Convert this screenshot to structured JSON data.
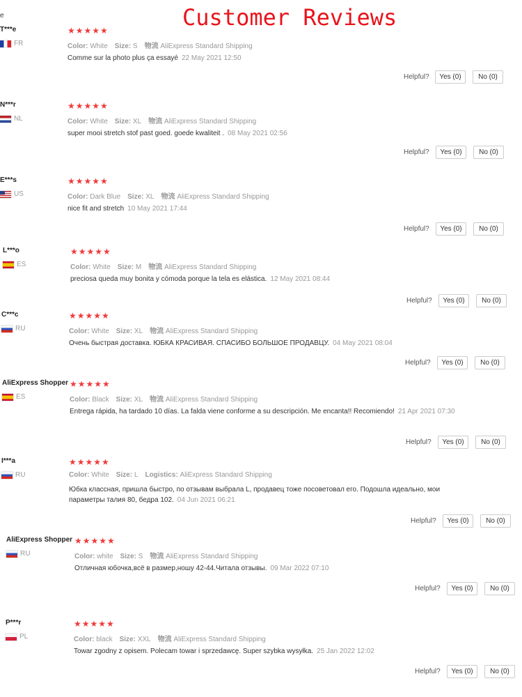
{
  "title": "Customer Reviews",
  "edge_fragment": "e",
  "labels": {
    "color": "Color:",
    "size": "Size:",
    "shipping": "物流",
    "logistics": "Logistics:",
    "helpful": "Helpful?",
    "yes": "Yes (0)",
    "no": "No (0)",
    "stars": "★★★★★"
  },
  "colors": {
    "title": "#e8141b",
    "stars": "#f03a3a"
  },
  "reviews": [
    {
      "name": "T***e",
      "country": "FR",
      "color": "White",
      "size": "S",
      "ship_label": "物流",
      "shipping": "AliExpress Standard Shipping",
      "text": "Comme sur la photo plus ça essayé",
      "date": "22 May 2021 12:50"
    },
    {
      "name": "N***r",
      "country": "NL",
      "color": "White",
      "size": "XL",
      "ship_label": "物流",
      "shipping": "AliExpress Standard Shipping",
      "text": "super mooi stretch stof past goed. goede kwaliteit .",
      "date": "08 May 2021 02:56"
    },
    {
      "name": "E***s",
      "country": "US",
      "color": "Dark Blue",
      "size": "XL",
      "ship_label": "物流",
      "shipping": "AliExpress Standard Shipping",
      "text": "nice fit and stretch",
      "date": "10 May 2021 17:44"
    },
    {
      "name": "L***o",
      "country": "ES",
      "color": "White",
      "size": "M",
      "ship_label": "物流",
      "shipping": "AliExpress Standard Shipping",
      "text": "preciosa queda muy bonita y cómoda porque la tela es elástica.",
      "date": "12 May 2021 08:44"
    },
    {
      "name": "C***c",
      "country": "RU",
      "color": "White",
      "size": "XL",
      "ship_label": "物流",
      "shipping": "AliExpress Standard Shipping",
      "text": "Очень быстрая доставка. ЮБКА КРАСИВАЯ. СПАСИБО БОЛЬШОЕ ПРОДАВЦУ.",
      "date": "04 May 2021 08:04"
    },
    {
      "name": "AliExpress Shopper",
      "country": "ES",
      "color": "Black",
      "size": "XL",
      "ship_label": "物流",
      "shipping": "AliExpress Standard Shipping",
      "text": "Entrega rápida, ha tardado 10 días. La falda viene conforme a su descripción. Me encanta!! Recomiendo!",
      "date": "21 Apr 2021 07:30"
    },
    {
      "name": "I***a",
      "country": "RU",
      "color": "White",
      "size": "L",
      "ship_label": "Logistics:",
      "shipping": "AliExpress Standard Shipping",
      "text": "Юбка классная, пришла быстро, по отзывам выбрала L, продавец тоже посоветовал его. Подошла идеально, мои параметры талия 80, бедра 102.",
      "date": "04 Jun 2021 06:21"
    },
    {
      "name": "AliExpress Shopper",
      "country": "RU",
      "color": "white",
      "size": "S",
      "ship_label": "物流",
      "shipping": "AliExpress Standard Shipping",
      "text": "Отличная юбочка,всё в размер,ношу 42-44.Читала отзывы.",
      "date": "09 Mar 2022 07:10"
    },
    {
      "name": "P***r",
      "country": "PL",
      "color": "black",
      "size": "XXL",
      "ship_label": "物流",
      "shipping": "AliExpress Standard Shipping",
      "text": "Towar zgodny z opisem. Polecam towar i sprzedawcę. Super szybka wysyłka.",
      "date": "25 Jan 2022 12:02"
    }
  ]
}
